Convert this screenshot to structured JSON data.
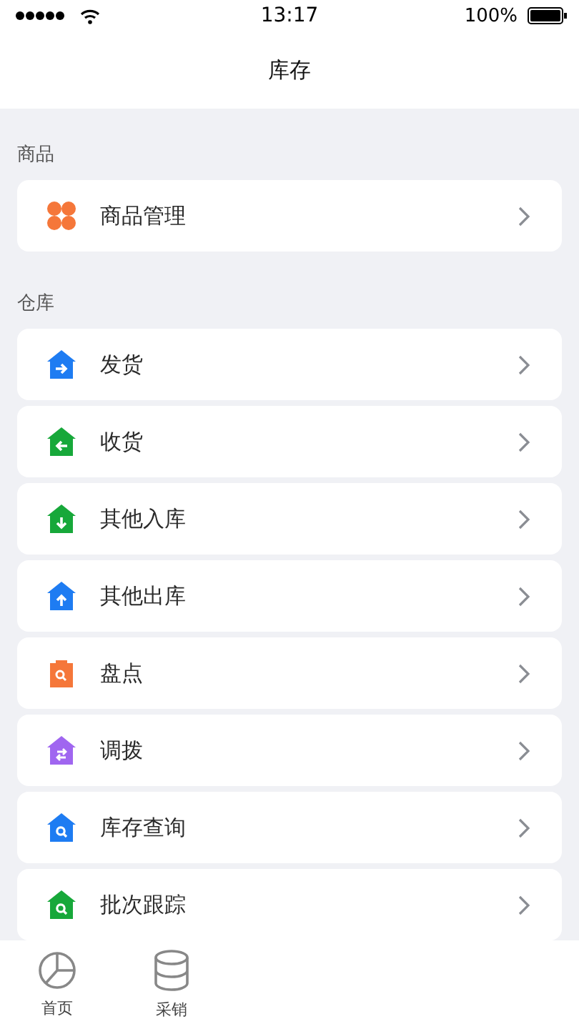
{
  "status_bar": {
    "time": "13:17",
    "battery": "100%"
  },
  "nav_bar": {
    "title": "库存"
  },
  "sections": [
    {
      "title": "商品",
      "items": [
        {
          "label": "商品管理",
          "kind": "grid",
          "color": "#f5773a"
        }
      ]
    },
    {
      "title": "仓库",
      "items": [
        {
          "label": "发货",
          "kind": "right",
          "color": "#1e7cf2"
        },
        {
          "label": "收货",
          "kind": "left",
          "color": "#17a83a"
        },
        {
          "label": "其他入库",
          "kind": "down",
          "color": "#17a83a"
        },
        {
          "label": "其他出库",
          "kind": "up",
          "color": "#1e7cf2"
        },
        {
          "label": "盘点",
          "kind": "clipboard",
          "color": "#f5773a"
        },
        {
          "label": "调拨",
          "kind": "swap",
          "color": "#a066f0"
        },
        {
          "label": "库存查询",
          "kind": "search",
          "color": "#1e7cf2"
        },
        {
          "label": "批次跟踪",
          "kind": "search",
          "color": "#17a83a"
        }
      ]
    }
  ],
  "tab_bar": [
    {
      "label": "首页",
      "kind": "pie",
      "selected": false
    },
    {
      "label": "采销",
      "kind": "database",
      "selected": false
    }
  ]
}
